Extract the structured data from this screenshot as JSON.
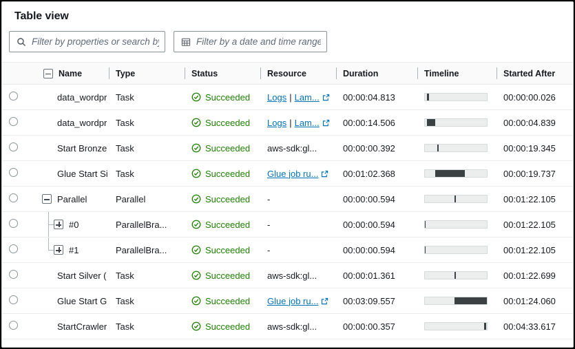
{
  "panel": {
    "title": "Table view"
  },
  "filters": {
    "search": {
      "placeholder": "Filter by properties or search by i",
      "icon": "search-icon"
    },
    "daterange": {
      "placeholder": "Filter by a date and time range",
      "icon": "calendar-icon"
    }
  },
  "columns": [
    {
      "key": "select",
      "label": ""
    },
    {
      "key": "name",
      "label": "Name"
    },
    {
      "key": "type",
      "label": "Type"
    },
    {
      "key": "status",
      "label": "Status"
    },
    {
      "key": "resource",
      "label": "Resource"
    },
    {
      "key": "duration",
      "label": "Duration"
    },
    {
      "key": "timeline",
      "label": "Timeline"
    },
    {
      "key": "started_after",
      "label": "Started After"
    }
  ],
  "rows": [
    {
      "name": "data_wordpr",
      "type": "Task",
      "status": "Succeeded",
      "resource_links": [
        "Logs",
        "Lam..."
      ],
      "resource_plain": "",
      "external_link": true,
      "duration": "00:00:04.813",
      "started_after": "00:00:00.026",
      "indent": 0,
      "toggle": "none",
      "timeline": {
        "start_pct": 3,
        "width_pct": 4
      }
    },
    {
      "name": "data_wordpr",
      "type": "Task",
      "status": "Succeeded",
      "resource_links": [
        "Logs",
        "Lam..."
      ],
      "resource_plain": "",
      "external_link": true,
      "duration": "00:00:14.506",
      "started_after": "00:00:04.839",
      "indent": 0,
      "toggle": "none",
      "timeline": {
        "start_pct": 3,
        "width_pct": 14
      }
    },
    {
      "name": "Start Bronze",
      "type": "Task",
      "status": "Succeeded",
      "resource_links": [],
      "resource_plain": "aws-sdk:gl...",
      "external_link": false,
      "duration": "00:00:00.392",
      "started_after": "00:00:19.345",
      "indent": 0,
      "toggle": "none",
      "timeline": {
        "start_pct": 20,
        "width_pct": 2
      }
    },
    {
      "name": "Glue Start Si",
      "type": "Task",
      "status": "Succeeded",
      "resource_links": [
        "Glue job ru..."
      ],
      "resource_plain": "",
      "external_link": true,
      "duration": "00:01:02.368",
      "started_after": "00:00:19.737",
      "indent": 0,
      "toggle": "none",
      "timeline": {
        "start_pct": 17,
        "width_pct": 48
      }
    },
    {
      "name": "Parallel",
      "type": "Parallel",
      "status": "Succeeded",
      "resource_links": [],
      "resource_plain": "-",
      "external_link": false,
      "duration": "00:00:00.594",
      "started_after": "00:01:22.105",
      "indent": 0,
      "toggle": "minus",
      "timeline": {
        "start_pct": 48,
        "width_pct": 2
      }
    },
    {
      "name": "#0",
      "type": "ParallelBra...",
      "status": "Succeeded",
      "resource_links": [],
      "resource_plain": "-",
      "external_link": false,
      "duration": "00:00:00.594",
      "started_after": "00:01:22.105",
      "indent": 1,
      "toggle": "plus",
      "timeline": {
        "start_pct": 0,
        "width_pct": 0
      }
    },
    {
      "name": "#1",
      "type": "ParallelBra...",
      "status": "Succeeded",
      "resource_links": [],
      "resource_plain": "-",
      "external_link": false,
      "duration": "00:00:00.594",
      "started_after": "00:01:22.105",
      "indent": 1,
      "toggle": "plus",
      "timeline": {
        "start_pct": 0,
        "width_pct": 0
      }
    },
    {
      "name": "Start Silver (",
      "type": "Task",
      "status": "Succeeded",
      "resource_links": [],
      "resource_plain": "aws-sdk:gl...",
      "external_link": false,
      "duration": "00:00:01.361",
      "started_after": "00:01:22.699",
      "indent": 0,
      "toggle": "none",
      "timeline": {
        "start_pct": 48,
        "width_pct": 2
      }
    },
    {
      "name": "Glue Start G",
      "type": "Task",
      "status": "Succeeded",
      "resource_links": [
        "Glue job ru..."
      ],
      "resource_plain": "",
      "external_link": true,
      "duration": "00:03:09.557",
      "started_after": "00:01:24.060",
      "indent": 0,
      "toggle": "none",
      "timeline": {
        "start_pct": 48,
        "width_pct": 52
      }
    },
    {
      "name": "StartCrawler",
      "type": "Task",
      "status": "Succeeded",
      "resource_links": [],
      "resource_plain": "aws-sdk:gl...",
      "external_link": false,
      "duration": "00:00:00.357",
      "started_after": "00:04:33.617",
      "indent": 0,
      "toggle": "none",
      "timeline": {
        "start_pct": 96,
        "width_pct": 3
      }
    }
  ],
  "colors": {
    "success": "#1d8102",
    "link": "#0073bb",
    "bar_fill": "#3b4043",
    "bar_track": "#eceded",
    "border": "#d5dbdb"
  }
}
